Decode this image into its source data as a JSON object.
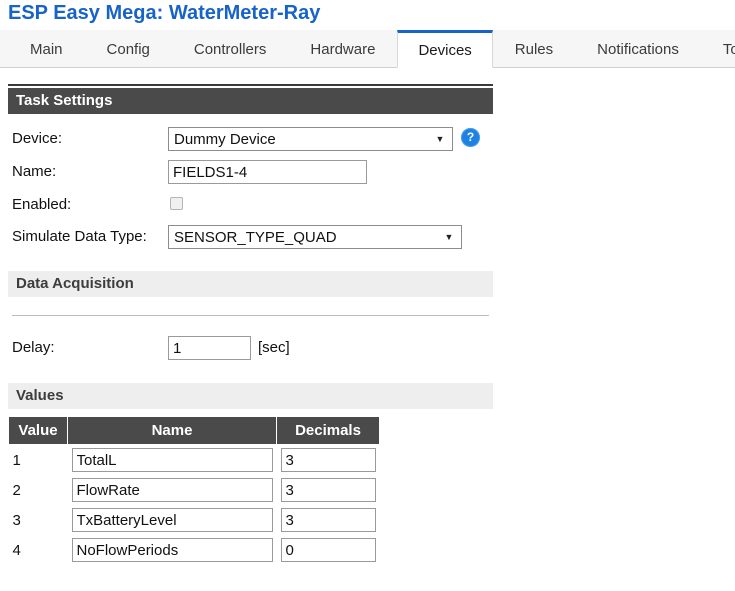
{
  "header": {
    "title": "ESP Easy Mega: WaterMeter-Ray",
    "title_color": "#1763c9"
  },
  "tabs": [
    {
      "label": "Main",
      "active": false
    },
    {
      "label": "Config",
      "active": false
    },
    {
      "label": "Controllers",
      "active": false
    },
    {
      "label": "Hardware",
      "active": false
    },
    {
      "label": "Devices",
      "active": true
    },
    {
      "label": "Rules",
      "active": false
    },
    {
      "label": "Notifications",
      "active": false
    },
    {
      "label": "Tools",
      "active": false
    }
  ],
  "task_settings": {
    "section_title": "Task Settings",
    "device_label": "Device:",
    "device_value": "Dummy Device",
    "help_icon": "question-mark-icon",
    "name_label": "Name:",
    "name_value": "FIELDS1-4",
    "enabled_label": "Enabled:",
    "enabled_checked": false,
    "simulate_label": "Simulate Data Type:",
    "simulate_value": "SENSOR_TYPE_QUAD"
  },
  "data_acquisition": {
    "section_title": "Data Acquisition",
    "delay_label": "Delay:",
    "delay_value": "1",
    "delay_unit": "[sec]"
  },
  "values": {
    "section_title": "Values",
    "columns": [
      "Value",
      "Name",
      "Decimals"
    ],
    "rows": [
      {
        "index": "1",
        "name": "TotalL",
        "decimals": "3"
      },
      {
        "index": "2",
        "name": "FlowRate",
        "decimals": "3"
      },
      {
        "index": "3",
        "name": "TxBatteryLevel",
        "decimals": "3"
      },
      {
        "index": "4",
        "name": "NoFlowPeriods",
        "decimals": "0"
      }
    ]
  },
  "icons": {
    "caret_down": "▼",
    "help": "?"
  }
}
